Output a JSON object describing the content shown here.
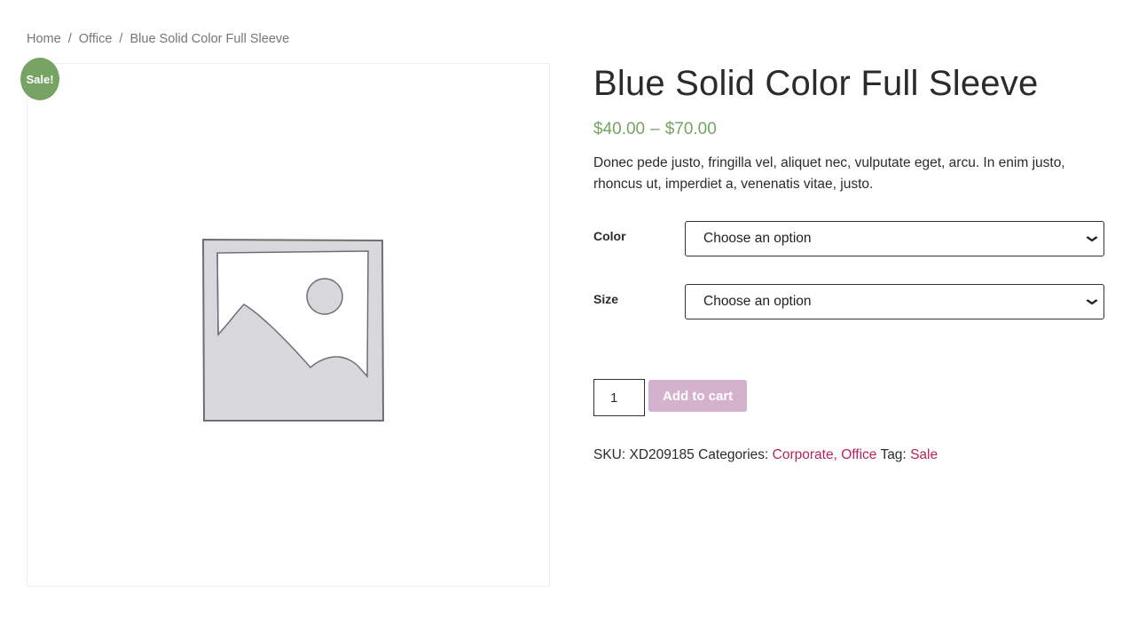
{
  "breadcrumb": {
    "home": "Home",
    "separator": "/",
    "category": "Office",
    "current": "Blue Solid Color Full Sleeve"
  },
  "badge": {
    "label": "Sale!"
  },
  "product": {
    "title": "Blue Solid Color Full Sleeve",
    "price_min": "$40.00",
    "price_dash": "–",
    "price_max": "$70.00",
    "description": "Donec pede justo, fringilla vel, aliquet nec, vulputate eget, arcu. In enim justo, rhoncus ut, imperdiet a, venenatis vitae, justo."
  },
  "variations": {
    "color_label": "Color",
    "color_value": "Choose an option",
    "size_label": "Size",
    "size_value": "Choose an option"
  },
  "cart": {
    "quantity": "1",
    "add_label": "Add to cart"
  },
  "meta": {
    "sku_label": "SKU:",
    "sku_value": "XD209185",
    "categories_label": "Categories:",
    "category_1": "Corporate,",
    "category_2": "Office",
    "tag_label": "Tag:",
    "tag_1": "Sale"
  },
  "icons": {
    "placeholder": "image-placeholder-icon",
    "dropdown": "chevron-down-icon"
  },
  "colors": {
    "price": "#77a464",
    "badge": "#77a464",
    "link": "#b5245c",
    "button": "#d4b1cc"
  }
}
